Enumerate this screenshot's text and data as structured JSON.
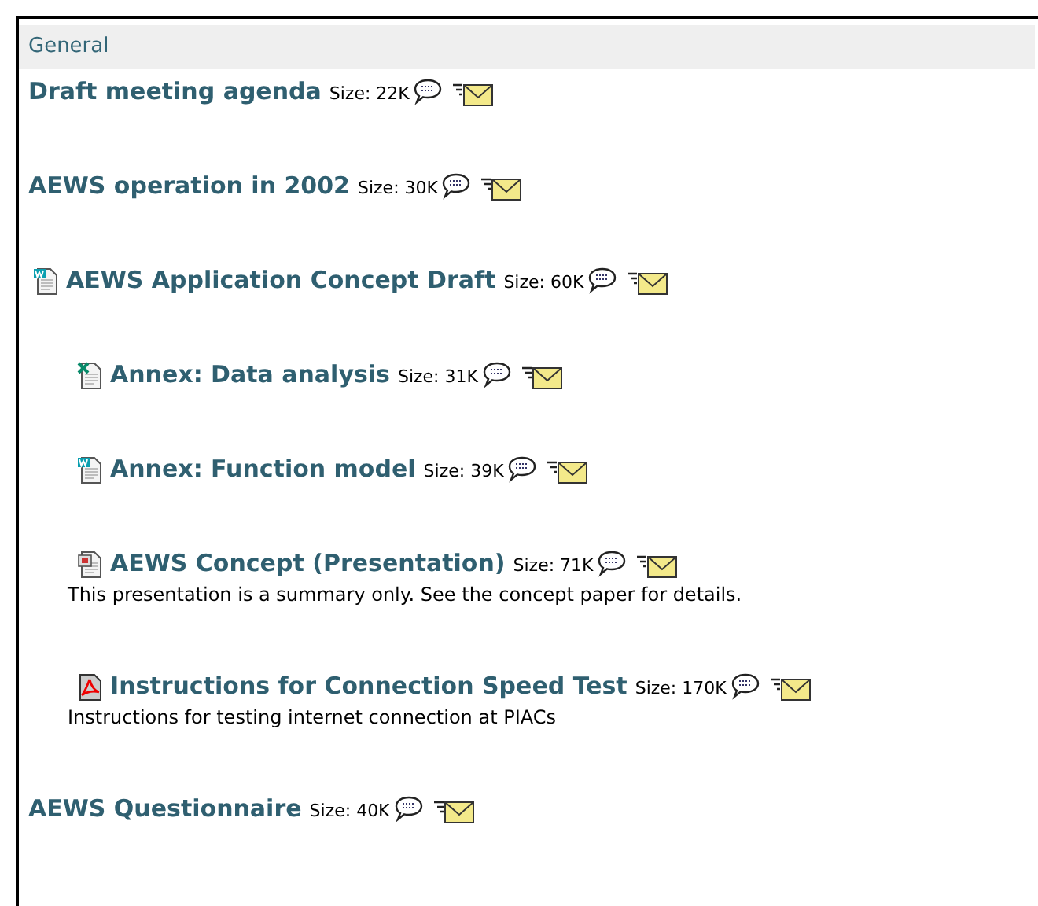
{
  "section": {
    "title": "General"
  },
  "documents": [
    {
      "title": "Draft meeting agenda",
      "size": "Size: 22K",
      "kind": "none"
    },
    {
      "title": "AEWS operation in 2002",
      "size": "Size: 30K",
      "kind": "none"
    },
    {
      "title": "AEWS Application Concept Draft",
      "size": "Size: 60K",
      "kind": "word",
      "children": [
        {
          "title": "Annex: Data analysis",
          "size": "Size: 31K",
          "kind": "excel"
        },
        {
          "title": "Annex: Function model",
          "size": "Size: 39K",
          "kind": "word"
        },
        {
          "title": "AEWS Concept (Presentation)",
          "size": "Size: 71K",
          "kind": "powerpoint",
          "description": "This presentation is a summary only. See the concept paper for details."
        },
        {
          "title": "Instructions for Connection Speed Test",
          "size": "Size: 170K",
          "kind": "pdf",
          "description": "Instructions for testing internet connection at PIACs"
        }
      ]
    },
    {
      "title": "AEWS Questionnaire",
      "size": "Size: 40K",
      "kind": "none"
    }
  ]
}
